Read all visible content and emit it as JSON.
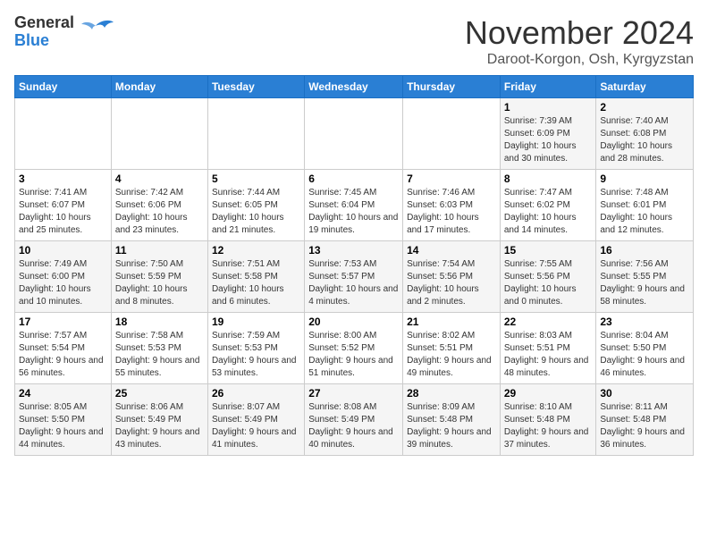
{
  "header": {
    "logo_line1": "General",
    "logo_line2": "Blue",
    "month": "November 2024",
    "location": "Daroot-Korgon, Osh, Kyrgyzstan"
  },
  "weekdays": [
    "Sunday",
    "Monday",
    "Tuesday",
    "Wednesday",
    "Thursday",
    "Friday",
    "Saturday"
  ],
  "weeks": [
    [
      {
        "day": "",
        "info": ""
      },
      {
        "day": "",
        "info": ""
      },
      {
        "day": "",
        "info": ""
      },
      {
        "day": "",
        "info": ""
      },
      {
        "day": "",
        "info": ""
      },
      {
        "day": "1",
        "info": "Sunrise: 7:39 AM\nSunset: 6:09 PM\nDaylight: 10 hours and 30 minutes."
      },
      {
        "day": "2",
        "info": "Sunrise: 7:40 AM\nSunset: 6:08 PM\nDaylight: 10 hours and 28 minutes."
      }
    ],
    [
      {
        "day": "3",
        "info": "Sunrise: 7:41 AM\nSunset: 6:07 PM\nDaylight: 10 hours and 25 minutes."
      },
      {
        "day": "4",
        "info": "Sunrise: 7:42 AM\nSunset: 6:06 PM\nDaylight: 10 hours and 23 minutes."
      },
      {
        "day": "5",
        "info": "Sunrise: 7:44 AM\nSunset: 6:05 PM\nDaylight: 10 hours and 21 minutes."
      },
      {
        "day": "6",
        "info": "Sunrise: 7:45 AM\nSunset: 6:04 PM\nDaylight: 10 hours and 19 minutes."
      },
      {
        "day": "7",
        "info": "Sunrise: 7:46 AM\nSunset: 6:03 PM\nDaylight: 10 hours and 17 minutes."
      },
      {
        "day": "8",
        "info": "Sunrise: 7:47 AM\nSunset: 6:02 PM\nDaylight: 10 hours and 14 minutes."
      },
      {
        "day": "9",
        "info": "Sunrise: 7:48 AM\nSunset: 6:01 PM\nDaylight: 10 hours and 12 minutes."
      }
    ],
    [
      {
        "day": "10",
        "info": "Sunrise: 7:49 AM\nSunset: 6:00 PM\nDaylight: 10 hours and 10 minutes."
      },
      {
        "day": "11",
        "info": "Sunrise: 7:50 AM\nSunset: 5:59 PM\nDaylight: 10 hours and 8 minutes."
      },
      {
        "day": "12",
        "info": "Sunrise: 7:51 AM\nSunset: 5:58 PM\nDaylight: 10 hours and 6 minutes."
      },
      {
        "day": "13",
        "info": "Sunrise: 7:53 AM\nSunset: 5:57 PM\nDaylight: 10 hours and 4 minutes."
      },
      {
        "day": "14",
        "info": "Sunrise: 7:54 AM\nSunset: 5:56 PM\nDaylight: 10 hours and 2 minutes."
      },
      {
        "day": "15",
        "info": "Sunrise: 7:55 AM\nSunset: 5:56 PM\nDaylight: 10 hours and 0 minutes."
      },
      {
        "day": "16",
        "info": "Sunrise: 7:56 AM\nSunset: 5:55 PM\nDaylight: 9 hours and 58 minutes."
      }
    ],
    [
      {
        "day": "17",
        "info": "Sunrise: 7:57 AM\nSunset: 5:54 PM\nDaylight: 9 hours and 56 minutes."
      },
      {
        "day": "18",
        "info": "Sunrise: 7:58 AM\nSunset: 5:53 PM\nDaylight: 9 hours and 55 minutes."
      },
      {
        "day": "19",
        "info": "Sunrise: 7:59 AM\nSunset: 5:53 PM\nDaylight: 9 hours and 53 minutes."
      },
      {
        "day": "20",
        "info": "Sunrise: 8:00 AM\nSunset: 5:52 PM\nDaylight: 9 hours and 51 minutes."
      },
      {
        "day": "21",
        "info": "Sunrise: 8:02 AM\nSunset: 5:51 PM\nDaylight: 9 hours and 49 minutes."
      },
      {
        "day": "22",
        "info": "Sunrise: 8:03 AM\nSunset: 5:51 PM\nDaylight: 9 hours and 48 minutes."
      },
      {
        "day": "23",
        "info": "Sunrise: 8:04 AM\nSunset: 5:50 PM\nDaylight: 9 hours and 46 minutes."
      }
    ],
    [
      {
        "day": "24",
        "info": "Sunrise: 8:05 AM\nSunset: 5:50 PM\nDaylight: 9 hours and 44 minutes."
      },
      {
        "day": "25",
        "info": "Sunrise: 8:06 AM\nSunset: 5:49 PM\nDaylight: 9 hours and 43 minutes."
      },
      {
        "day": "26",
        "info": "Sunrise: 8:07 AM\nSunset: 5:49 PM\nDaylight: 9 hours and 41 minutes."
      },
      {
        "day": "27",
        "info": "Sunrise: 8:08 AM\nSunset: 5:49 PM\nDaylight: 9 hours and 40 minutes."
      },
      {
        "day": "28",
        "info": "Sunrise: 8:09 AM\nSunset: 5:48 PM\nDaylight: 9 hours and 39 minutes."
      },
      {
        "day": "29",
        "info": "Sunrise: 8:10 AM\nSunset: 5:48 PM\nDaylight: 9 hours and 37 minutes."
      },
      {
        "day": "30",
        "info": "Sunrise: 8:11 AM\nSunset: 5:48 PM\nDaylight: 9 hours and 36 minutes."
      }
    ]
  ]
}
